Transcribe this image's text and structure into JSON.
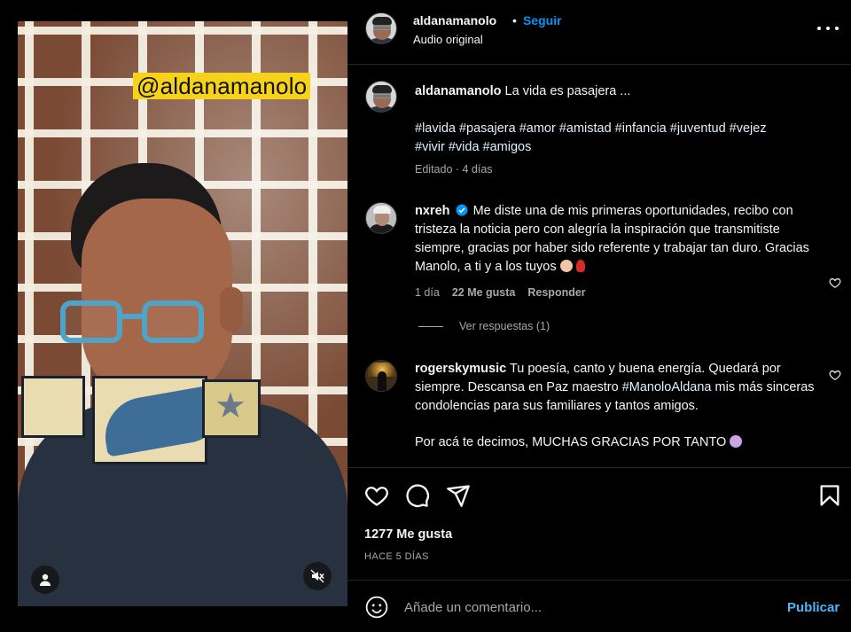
{
  "post": {
    "username": "aldanamanolo",
    "dot": "•",
    "follow_label": "Seguir",
    "audio": "Audio original",
    "video_overlay_text": "@aldanamanolo"
  },
  "caption": {
    "username": "aldanamanolo",
    "text": "La vida es pasajera ...",
    "hashtags_line1": "#lavida #pasajera #amor #amistad #infancia #juventud #vejez",
    "hashtags_line2": "#vivir #vida #amigos",
    "meta": "Editado · 4 días"
  },
  "comments": [
    {
      "username": "nxreh",
      "verified": true,
      "text": "Me diste una de mis primeras oportunidades, recibo con tristeza la noticia pero con alegría la inspiración que transmitiste siempre, gracias por haber sido referente y trabajar tan duro. Gracias Manolo, a ti y a los tuyos",
      "time": "1 día",
      "likes": "22 Me gusta",
      "reply": "Responder",
      "view_replies": "Ver respuestas (1)"
    },
    {
      "username": "rogerskymusic",
      "text_before": "Tu poesía, canto y buena energía. Quedará por siempre. Descansa en Paz maestro",
      "mention": "#ManoloAldana",
      "text_after": "mis más sinceras condolencias para sus familiares y tantos amigos.",
      "text_second": "Por acá te decimos, MUCHAS GRACIAS POR TANTO"
    }
  ],
  "actions": {
    "likes": "1277 Me gusta",
    "date": "HACE 5 DÍAS"
  },
  "add_comment": {
    "placeholder": "Añade un comentario...",
    "publish_label": "Publicar"
  },
  "colors": {
    "background": "#000000",
    "accent": "#0095f6",
    "publish": "#4cb5f9",
    "muted": "#a8a8a8",
    "overlay_tag": "#f7d21a"
  },
  "icons": [
    "user-icon",
    "mute-icon",
    "more-icon",
    "heart-icon",
    "comment-icon",
    "share-icon",
    "bookmark-icon",
    "emoji-icon",
    "verified-icon"
  ]
}
